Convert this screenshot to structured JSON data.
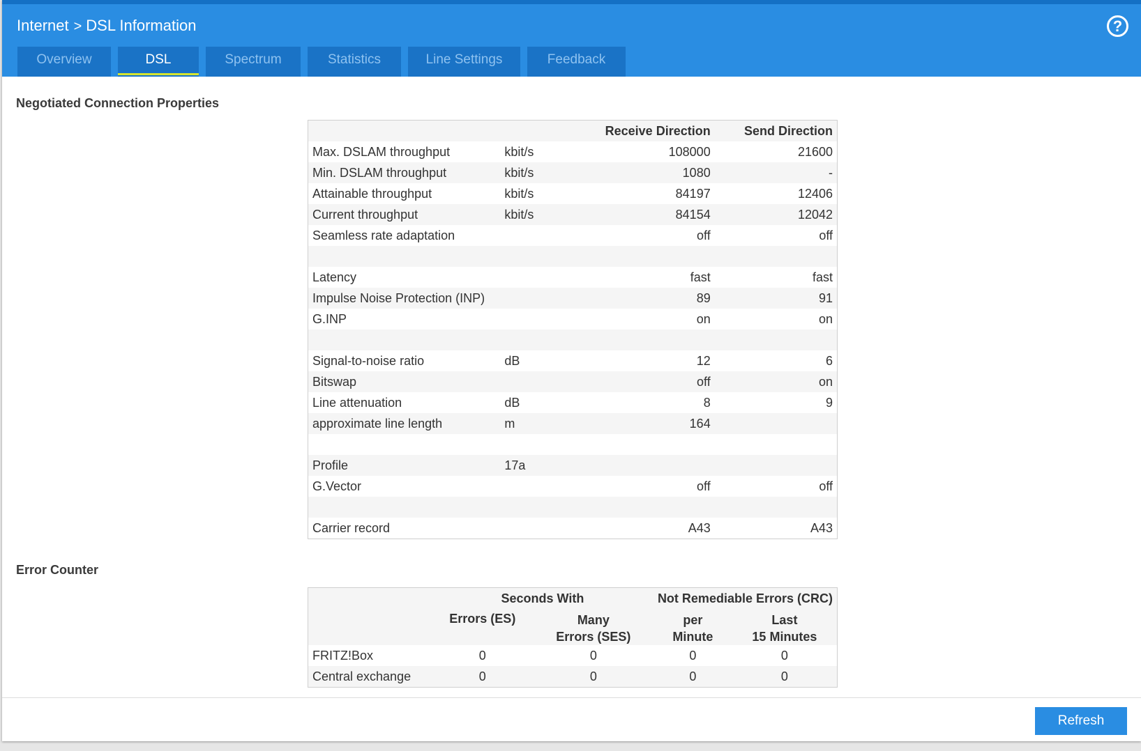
{
  "header": {
    "breadcrumb_parent": "Internet",
    "breadcrumb_separator": ">",
    "breadcrumb_current": "DSL Information",
    "help_label": "?",
    "help_icon": "question-circle-icon"
  },
  "tabs": [
    {
      "label": "Overview",
      "active": false
    },
    {
      "label": "DSL",
      "active": true
    },
    {
      "label": "Spectrum",
      "active": false
    },
    {
      "label": "Statistics",
      "active": false
    },
    {
      "label": "Line Settings",
      "active": false
    },
    {
      "label": "Feedback",
      "active": false
    }
  ],
  "connection": {
    "title": "Negotiated Connection Properties",
    "col_receive": "Receive Direction",
    "col_send": "Send Direction",
    "rows": [
      {
        "label": "Max. DSLAM throughput",
        "unit": "kbit/s",
        "rx": "108000",
        "tx": "21600"
      },
      {
        "label": "Min. DSLAM throughput",
        "unit": "kbit/s",
        "rx": "1080",
        "tx": "-"
      },
      {
        "label": "Attainable throughput",
        "unit": "kbit/s",
        "rx": "84197",
        "tx": "12406"
      },
      {
        "label": "Current throughput",
        "unit": "kbit/s",
        "rx": "84154",
        "tx": "12042"
      },
      {
        "label": "Seamless rate adaptation",
        "unit": "",
        "rx": "off",
        "tx": "off"
      },
      {
        "label": "",
        "unit": "",
        "rx": "",
        "tx": ""
      },
      {
        "label": "Latency",
        "unit": "",
        "rx": "fast",
        "tx": "fast"
      },
      {
        "label": "Impulse Noise Protection (INP)",
        "unit": "",
        "rx": "89",
        "tx": "91"
      },
      {
        "label": "G.INP",
        "unit": "",
        "rx": "on",
        "tx": "on"
      },
      {
        "label": "",
        "unit": "",
        "rx": "",
        "tx": ""
      },
      {
        "label": "Signal-to-noise ratio",
        "unit": "dB",
        "rx": "12",
        "tx": "6"
      },
      {
        "label": "Bitswap",
        "unit": "",
        "rx": "off",
        "tx": "on"
      },
      {
        "label": "Line attenuation",
        "unit": "dB",
        "rx": "8",
        "tx": "9"
      },
      {
        "label": "approximate line length",
        "unit": "m",
        "rx": "164",
        "tx": ""
      },
      {
        "label": "",
        "unit": "",
        "rx": "",
        "tx": ""
      },
      {
        "label": "Profile",
        "unit": "17a",
        "rx": "",
        "tx": ""
      },
      {
        "label": "G.Vector",
        "unit": "",
        "rx": "off",
        "tx": "off"
      },
      {
        "label": "",
        "unit": "",
        "rx": "",
        "tx": ""
      },
      {
        "label": "Carrier record",
        "unit": "",
        "rx": "A43",
        "tx": "A43"
      }
    ]
  },
  "errors": {
    "title": "Error Counter",
    "group_seconds": "Seconds With",
    "group_crc": "Not Remediable Errors (CRC)",
    "col_es": "Errors (ES)",
    "col_ses_1": "Many",
    "col_ses_2": "Errors (SES)",
    "col_pm_1": "per",
    "col_pm_2": "Minute",
    "col_l15_1": "Last",
    "col_l15_2": "15 Minutes",
    "rows": [
      {
        "label": "FRITZ!Box",
        "es": "0",
        "ses": "0",
        "per_minute": "0",
        "last_15": "0"
      },
      {
        "label": "Central exchange",
        "es": "0",
        "ses": "0",
        "per_minute": "0",
        "last_15": "0"
      }
    ]
  },
  "footer": {
    "refresh_label": "Refresh"
  },
  "colors": {
    "header_blue": "#2a8de2",
    "tab_blue": "#1a73c6",
    "active_underline": "#d7e52f"
  }
}
